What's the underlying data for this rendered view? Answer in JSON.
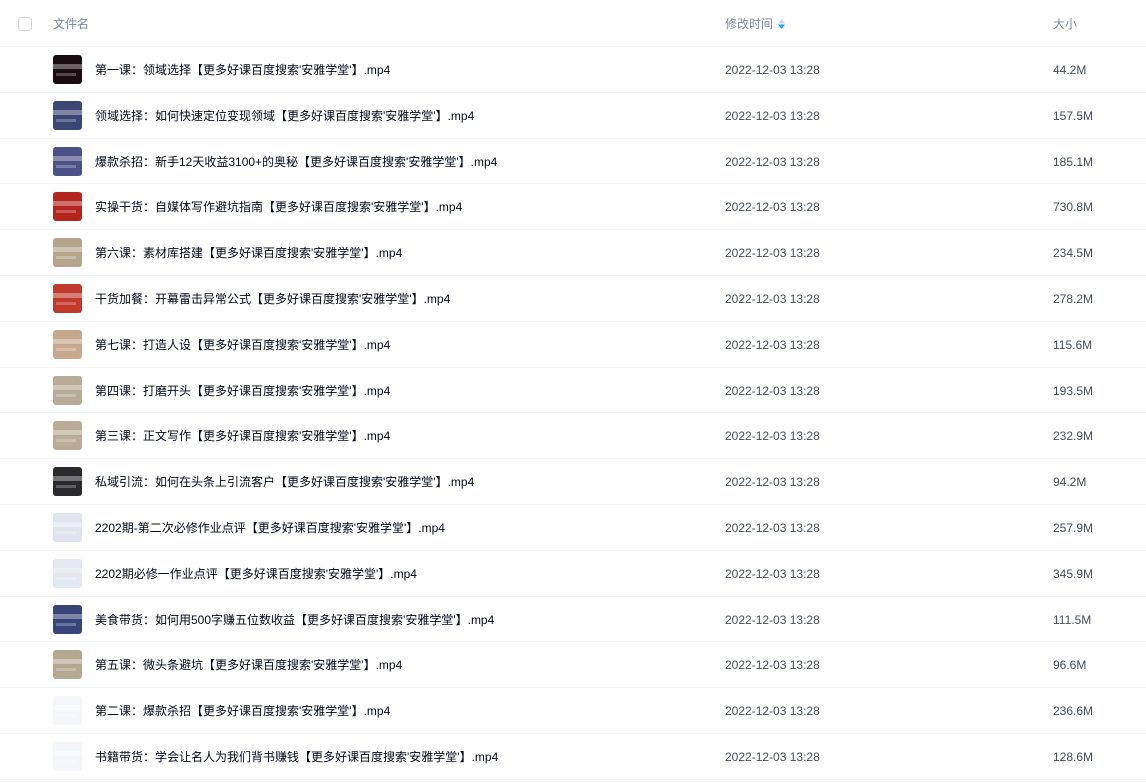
{
  "header": {
    "name_label": "文件名",
    "time_label": "修改时间",
    "size_label": "大小",
    "sort_icon": "sort-arrows-icon",
    "sort_colors": {
      "active": "#06a7ff",
      "inactive": "#c4d8f5"
    }
  },
  "files": [
    {
      "name": "第一课：领域选择【更多好课百度搜索'安雅学堂'】.mp4",
      "modified": "2022-12-03 13:28",
      "size": "44.2M",
      "thumb_color": "#1a0d12"
    },
    {
      "name": "领域选择：如何快速定位变现领域【更多好课百度搜索'安雅学堂'】.mp4",
      "modified": "2022-12-03 13:28",
      "size": "157.5M",
      "thumb_color": "#3b4674"
    },
    {
      "name": "爆款杀招：新手12天收益3100+的奥秘【更多好课百度搜索'安雅学堂'】.mp4",
      "modified": "2022-12-03 13:28",
      "size": "185.1M",
      "thumb_color": "#4a5288"
    },
    {
      "name": "实操干货：自媒体写作避坑指南【更多好课百度搜索'安雅学堂'】.mp4",
      "modified": "2022-12-03 13:28",
      "size": "730.8M",
      "thumb_color": "#b3261e"
    },
    {
      "name": "第六课：素材库搭建【更多好课百度搜索'安雅学堂'】.mp4",
      "modified": "2022-12-03 13:28",
      "size": "234.5M",
      "thumb_color": "#b5a58c"
    },
    {
      "name": "干货加餐：开幕雷击异常公式【更多好课百度搜索'安雅学堂'】.mp4",
      "modified": "2022-12-03 13:28",
      "size": "278.2M",
      "thumb_color": "#c0392b"
    },
    {
      "name": "第七课：打造人设【更多好课百度搜索'安雅学堂'】.mp4",
      "modified": "2022-12-03 13:28",
      "size": "115.6M",
      "thumb_color": "#c8a88c"
    },
    {
      "name": "第四课：打磨开头【更多好课百度搜索'安雅学堂'】.mp4",
      "modified": "2022-12-03 13:28",
      "size": "193.5M",
      "thumb_color": "#b8ab98"
    },
    {
      "name": "第三课：正文写作【更多好课百度搜索'安雅学堂'】.mp4",
      "modified": "2022-12-03 13:28",
      "size": "232.9M",
      "thumb_color": "#b9ab95"
    },
    {
      "name": "私域引流：如何在头条上引流客户【更多好课百度搜索'安雅学堂'】.mp4",
      "modified": "2022-12-03 13:28",
      "size": "94.2M",
      "thumb_color": "#2a2a2c"
    },
    {
      "name": "2202期-第二次必修作业点评【更多好课百度搜索'安雅学堂'】.mp4",
      "modified": "2022-12-03 13:28",
      "size": "257.9M",
      "thumb_color": "#dfe4ee"
    },
    {
      "name": "2202期必修一作业点评【更多好课百度搜索'安雅学堂'】.mp4",
      "modified": "2022-12-03 13:28",
      "size": "345.9M",
      "thumb_color": "#e3e7ef"
    },
    {
      "name": "美食带货：如何用500字赚五位数收益【更多好课百度搜索'安雅学堂'】.mp4",
      "modified": "2022-12-03 13:28",
      "size": "111.5M",
      "thumb_color": "#39457a"
    },
    {
      "name": "第五课：微头条避坑【更多好课百度搜索'安雅学堂'】.mp4",
      "modified": "2022-12-03 13:28",
      "size": "96.6M",
      "thumb_color": "#b6a790"
    },
    {
      "name": "第二课：爆款杀招【更多好课百度搜索'安雅学堂'】.mp4",
      "modified": "2022-12-03 13:28",
      "size": "236.6M",
      "thumb_color": "#f4f6fa"
    },
    {
      "name": "书籍带货：学会让名人为我们背书赚钱【更多好课百度搜索'安雅学堂'】.mp4",
      "modified": "2022-12-03 13:28",
      "size": "128.6M",
      "thumb_color": "#f4f6fa"
    }
  ]
}
